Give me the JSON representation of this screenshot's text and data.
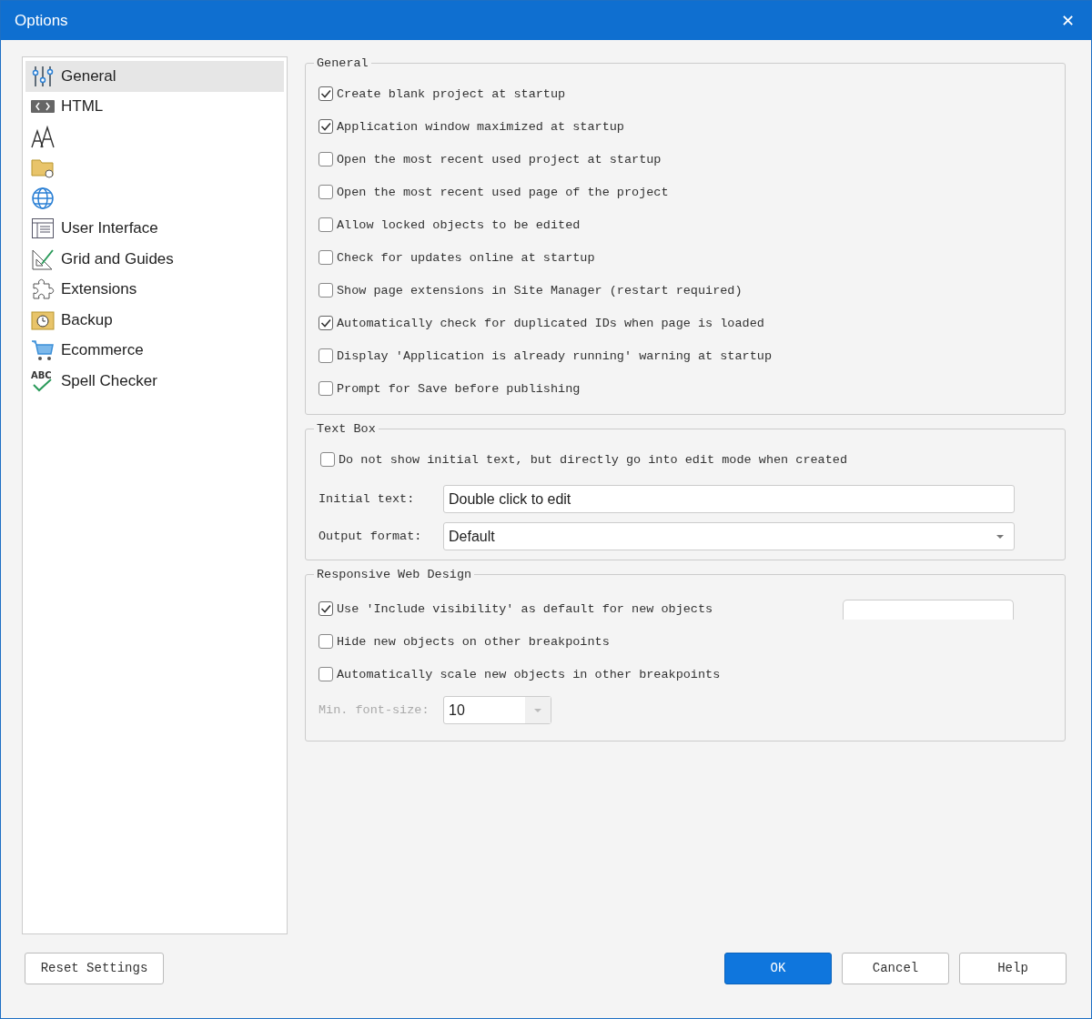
{
  "window": {
    "title": "Options",
    "close": "✕"
  },
  "sidebar": {
    "items": [
      {
        "kind": "sliders",
        "label": "General",
        "selected": true
      },
      {
        "kind": "code",
        "label": "HTML",
        "selected": false
      },
      {
        "kind": "font",
        "selected": false
      },
      {
        "kind": "folder",
        "selected": false
      },
      {
        "kind": "globe",
        "selected": false
      },
      {
        "kind": "window",
        "label": "User Interface",
        "selected": false
      },
      {
        "kind": "grid",
        "label": "Grid and Guides",
        "selected": false
      },
      {
        "kind": "puzzle",
        "label": "Extensions",
        "selected": false
      },
      {
        "kind": "backup",
        "label": "Backup",
        "selected": false
      },
      {
        "kind": "cart",
        "label": "Ecommerce",
        "selected": false
      },
      {
        "kind": "spell",
        "icon_text": "ABC",
        "label": "Spell Checker",
        "selected": false
      }
    ]
  },
  "general": {
    "legend": "General",
    "options": [
      {
        "label": "Create blank project at startup",
        "checked": true
      },
      {
        "label": "Application window maximized at startup",
        "checked": true
      },
      {
        "label": "Open the most recent used project at startup",
        "checked": false
      },
      {
        "label": "Open the most recent used page of the project",
        "checked": false
      },
      {
        "label": "Allow locked objects to be edited",
        "checked": false
      },
      {
        "label": "Check for updates online at startup",
        "checked": false
      },
      {
        "label": "Show page extensions in Site Manager (restart required)",
        "checked": false
      },
      {
        "label": "Automatically check for duplicated IDs when page is loaded",
        "checked": true
      },
      {
        "label": "Display 'Application is already running' warning at startup",
        "checked": false
      },
      {
        "label": "Prompt for Save before publishing",
        "checked": false
      }
    ]
  },
  "text_box": {
    "legend": "Text Box",
    "option": {
      "label": "Do not show initial text, but directly go into edit mode when created",
      "checked": false
    },
    "initial_text": {
      "label": "Initial text:",
      "value": "Double click to edit"
    },
    "output_format": {
      "label": "Output format:",
      "value": "Default"
    }
  },
  "responsive": {
    "legend": "Responsive Web Design",
    "options": [
      {
        "label": "Use 'Include visibility' as default for new objects",
        "checked": true
      },
      {
        "label": "Hide new objects on other breakpoints",
        "checked": false
      },
      {
        "label": "Automatically scale new objects in other breakpoints",
        "checked": false
      }
    ],
    "min_font_size": {
      "label": "Min. font-size:",
      "value": "10",
      "disabled": true
    }
  },
  "buttons": {
    "reset": "Reset Settings",
    "ok": "OK",
    "cancel": "Cancel",
    "help": "Help"
  }
}
